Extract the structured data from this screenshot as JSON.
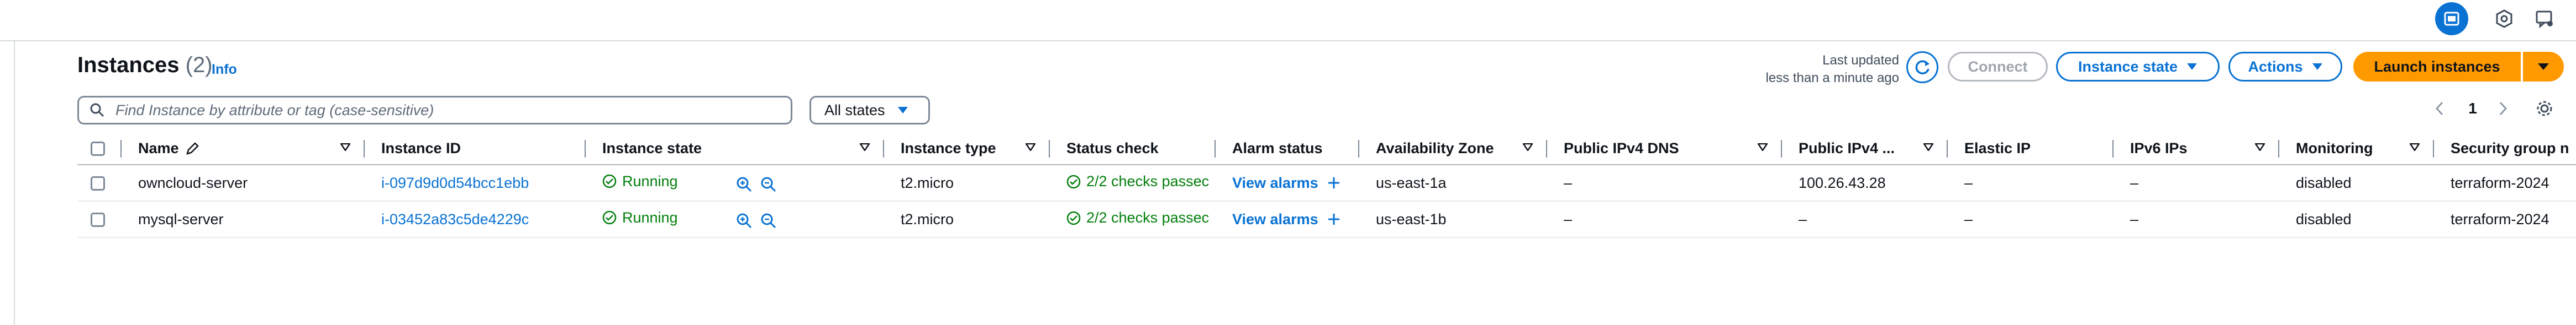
{
  "header": {
    "title": "Instances",
    "count": "(2)",
    "info_label": "Info",
    "last_updated_line1": "Last updated",
    "last_updated_line2": "less than a minute ago"
  },
  "toolbar": {
    "connect_label": "Connect",
    "instance_state_label": "Instance state",
    "actions_label": "Actions",
    "launch_label": "Launch instances"
  },
  "filter": {
    "search_placeholder": "Find Instance by attribute or tag (case-sensitive)",
    "state_select_value": "All states"
  },
  "pagination": {
    "current_page": "1"
  },
  "table": {
    "columns": [
      "Name",
      "Instance ID",
      "Instance state",
      "Instance type",
      "Status check",
      "Alarm status",
      "Availability Zone",
      "Public IPv4 DNS",
      "Public IPv4 ...",
      "Elastic IP",
      "IPv6 IPs",
      "Monitoring",
      "Security group n"
    ],
    "rows": [
      {
        "name": "owncloud-server",
        "instance_id": "i-097d9d0d54bcc1ebb",
        "state": "Running",
        "type": "t2.micro",
        "status_check": "2/2 checks passec",
        "alarm_status": "View alarms",
        "az": "us-east-1a",
        "public_dns": "–",
        "public_ipv4": "100.26.43.28",
        "elastic_ip": "–",
        "ipv6": "–",
        "monitoring": "disabled",
        "security_group": "terraform-2024"
      },
      {
        "name": "mysql-server",
        "instance_id": "i-03452a83c5de4229c",
        "state": "Running",
        "type": "t2.micro",
        "status_check": "2/2 checks passec",
        "alarm_status": "View alarms",
        "az": "us-east-1b",
        "public_dns": "–",
        "public_ipv4": "–",
        "elastic_ip": "–",
        "ipv6": "–",
        "monitoring": "disabled",
        "security_group": "terraform-2024"
      }
    ]
  },
  "colors": {
    "link_blue": "#0972d3",
    "success_green": "#037f0c",
    "primary_orange": "#ff9900"
  },
  "icons": [
    "cloudshell-icon",
    "settings-hex-icon",
    "feedback-icon",
    "refresh-icon",
    "edit-icon",
    "zoom-in-icon",
    "zoom-out-icon",
    "check-circle-icon",
    "plus-icon",
    "caret-down-icon",
    "chevron-left-icon",
    "chevron-right-icon",
    "gear-icon"
  ]
}
